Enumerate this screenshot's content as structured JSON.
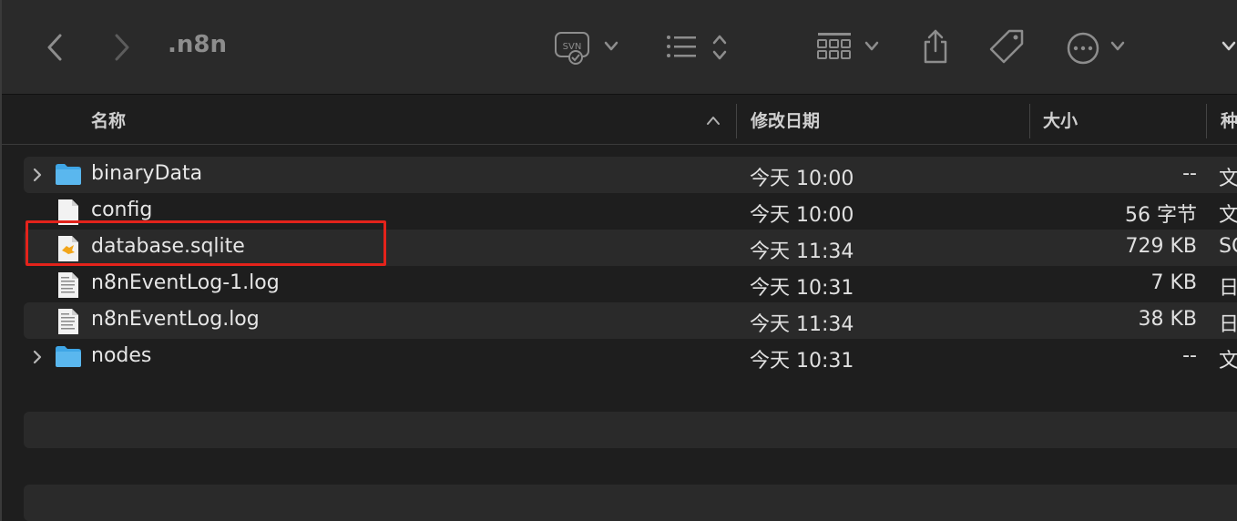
{
  "window": {
    "title": ".n8n"
  },
  "toolbar": {
    "icons": [
      "back-icon",
      "forward-icon",
      "svn-icon",
      "list-view-icon",
      "group-icon",
      "share-icon",
      "tag-icon",
      "more-icon",
      "chevron-down-icon"
    ],
    "svn_label": "SVN"
  },
  "columns": {
    "name": "名称",
    "modified": "修改日期",
    "size": "大小",
    "kind": "种"
  },
  "files": [
    {
      "name": "binaryData",
      "modified": "今天 10:00",
      "size": "--",
      "kind": "文",
      "type": "folder",
      "expandable": true
    },
    {
      "name": "config",
      "modified": "今天 10:00",
      "size": "56 字节",
      "kind": "文",
      "type": "file",
      "expandable": false
    },
    {
      "name": "database.sqlite",
      "modified": "今天 11:34",
      "size": "729 KB",
      "kind": "SC",
      "type": "sqlite",
      "expandable": false
    },
    {
      "name": "n8nEventLog-1.log",
      "modified": "今天 10:31",
      "size": "7 KB",
      "kind": "日",
      "type": "log",
      "expandable": false
    },
    {
      "name": "n8nEventLog.log",
      "modified": "今天 11:34",
      "size": "38 KB",
      "kind": "日",
      "type": "log",
      "expandable": false
    },
    {
      "name": "nodes",
      "modified": "今天 10:31",
      "size": "--",
      "kind": "文",
      "type": "folder",
      "expandable": true
    }
  ],
  "colors": {
    "highlight": "#e3231b",
    "folder": "#5ab7ee",
    "sqlite_accent": "#f2a51a"
  }
}
